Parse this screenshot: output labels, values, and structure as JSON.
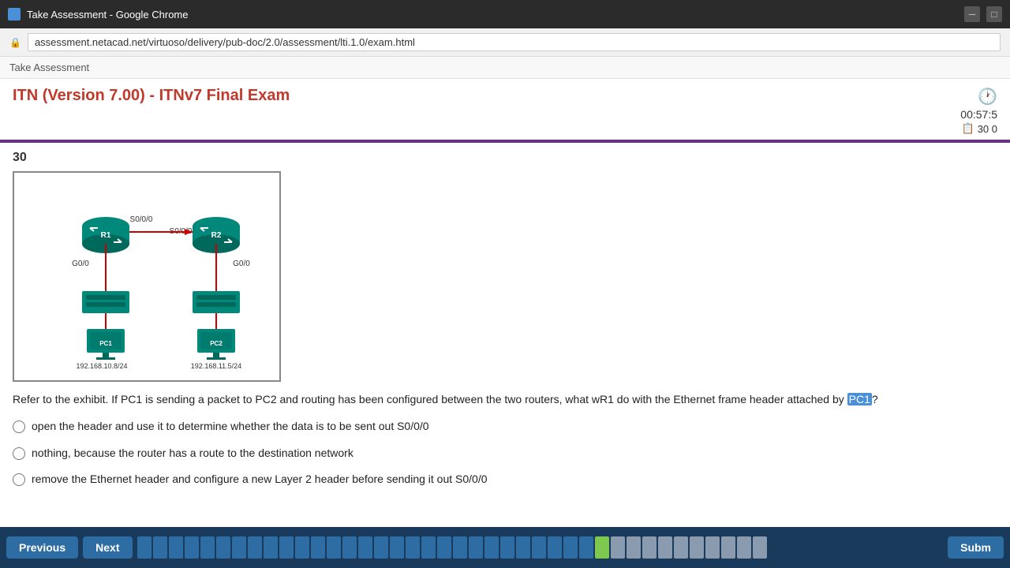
{
  "browser": {
    "titlebar_title": "Take Assessment - Google Chrome",
    "address_url": "assessment.netacad.net/virtuoso/delivery/pub-doc/2.0/assessment/lti.1.0/exam.html",
    "breadcrumb": "Take Assessment"
  },
  "header": {
    "title": "ITN (Version 7.00) - ITNv7 Final Exam",
    "timer_label": "00:57:5",
    "items_label": "30 0"
  },
  "question": {
    "number": "30",
    "text_part1": "Refer to the exhibit. If PC1 is sending a packet to PC2 and routing has been configured between the two routers, what w",
    "text_highlight": "R1",
    "text_part2": " do with the Ethernet frame header attached by ",
    "text_highlight2": "PC1",
    "text_part3": "?"
  },
  "answers": [
    {
      "id": "a",
      "text": "open the header and use it to determine whether the data is to be sent out S0/0/0"
    },
    {
      "id": "b",
      "text": "nothing, because the router has a route to the destination network"
    },
    {
      "id": "c",
      "text": "remove the Ethernet header and configure a new Layer 2 header before sending it out S0/0/0"
    }
  ],
  "navigation": {
    "previous_label": "Previous",
    "next_label": "Next",
    "submit_label": "Subm",
    "total_questions": 30,
    "answered_count": 29,
    "current_question": 30
  },
  "network": {
    "r1_label": "R1",
    "r2_label": "R2",
    "pc1_label": "PC1",
    "pc2_label": "PC2",
    "s0_0_0_top": "S0/0/0",
    "s0_0_0_bottom": "S0/0/0",
    "g0_0_left": "G0/0",
    "g0_0_right": "G0/0",
    "subnet1": "192.168.10.8/24",
    "subnet2": "192.168.11.5/24"
  }
}
